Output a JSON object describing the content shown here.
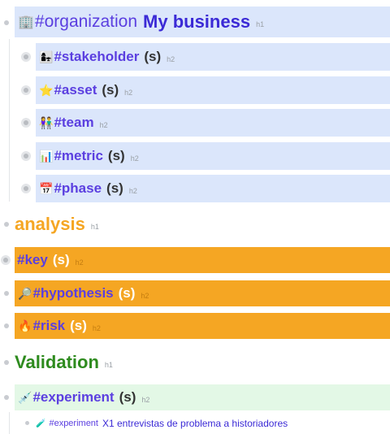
{
  "outline": {
    "organization": {
      "tag": "#organization",
      "title": "My business",
      "level": "h1",
      "icon": "office-building-icon"
    },
    "stakeholder": {
      "tag": "#stakeholder",
      "suffix": "(s)",
      "level": "h2",
      "icon": "people-icon"
    },
    "asset": {
      "tag": "#asset",
      "suffix": "(s)",
      "level": "h2",
      "icon": "star-icon"
    },
    "team": {
      "tag": "#team",
      "level": "h2",
      "icon": "team-icon"
    },
    "metric": {
      "tag": "#metric",
      "suffix": "(s)",
      "level": "h2",
      "icon": "bar-chart-icon"
    },
    "phase": {
      "tag": "#phase",
      "suffix": "(s)",
      "level": "h2",
      "icon": "calendar-icon"
    },
    "analysis": {
      "title": "analysis",
      "level": "h1"
    },
    "key": {
      "tag": "#key",
      "suffix": "(s)",
      "level": "h2"
    },
    "hypothesis": {
      "tag": "#hypothesis",
      "suffix": "(s)",
      "level": "h2",
      "icon": "magnifier-icon"
    },
    "risk": {
      "tag": "#risk",
      "suffix": "(s)",
      "level": "h2",
      "icon": "fire-icon"
    },
    "validation": {
      "title": "Validation",
      "level": "h1"
    },
    "experiment": {
      "tag": "#experiment",
      "suffix": "(s)",
      "level": "h2",
      "icon": "syringe-icon"
    },
    "experiment_item": {
      "tag": "#experiment",
      "text": "X1 entrevistas de problema a historiadores",
      "icon": "test-tube-icon"
    }
  },
  "colors": {
    "blue_block": "#dbe6fb",
    "orange_block": "#f5a623",
    "green_block": "#e3f8e6",
    "tag_purple": "#5b3fe0",
    "analysis_orange": "#f5a623",
    "validation_green": "#2e8b1e"
  }
}
